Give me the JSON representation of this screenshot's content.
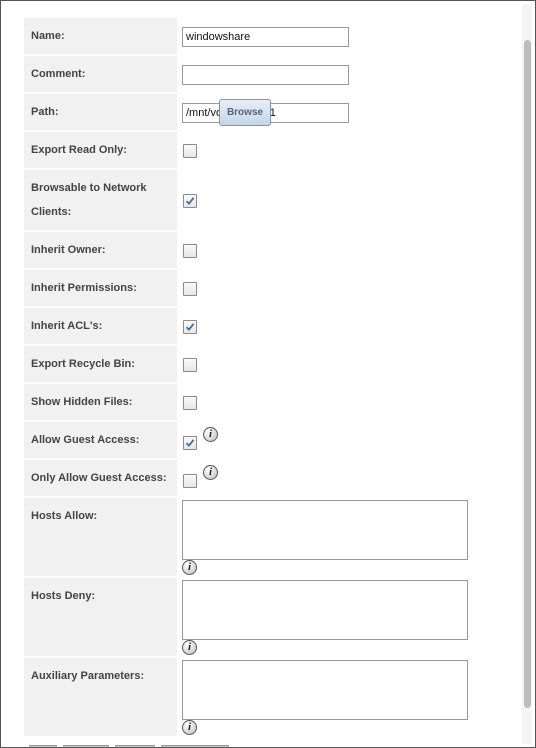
{
  "form": {
    "name_label": "Name:",
    "name_value": "windowshare",
    "comment_label": "Comment:",
    "comment_value": "",
    "path_label": "Path:",
    "path_value": "/mnt/vol1/dataset1",
    "browse_label": "Browse",
    "export_read_only_label": "Export Read Only:",
    "export_read_only_checked": false,
    "browsable_label_line1": "Browsable to Network",
    "browsable_label_line2": "Clients:",
    "browsable_checked": true,
    "inherit_owner_label": "Inherit Owner:",
    "inherit_owner_checked": false,
    "inherit_permissions_label": "Inherit Permissions:",
    "inherit_permissions_checked": false,
    "inherit_acls_label": "Inherit ACL's:",
    "inherit_acls_checked": true,
    "export_recycle_bin_label": "Export Recycle Bin:",
    "export_recycle_bin_checked": false,
    "show_hidden_files_label": "Show Hidden Files:",
    "show_hidden_files_checked": false,
    "allow_guest_access_label": "Allow Guest Access:",
    "allow_guest_access_checked": true,
    "only_allow_guest_access_label": "Only Allow Guest Access:",
    "only_allow_guest_access_checked": false,
    "hosts_allow_label": "Hosts Allow:",
    "hosts_allow_value": "",
    "hosts_deny_label": "Hosts Deny:",
    "hosts_deny_value": "",
    "auxiliary_parameters_label": "Auxiliary Parameters:",
    "auxiliary_parameters_value": ""
  },
  "icons": {
    "info": "info-icon",
    "info_glyph": "i"
  },
  "colors": {
    "label_background": "#f1f1f1",
    "checkmark": "#3d6f96",
    "browse_button": "#c4d5ea"
  }
}
